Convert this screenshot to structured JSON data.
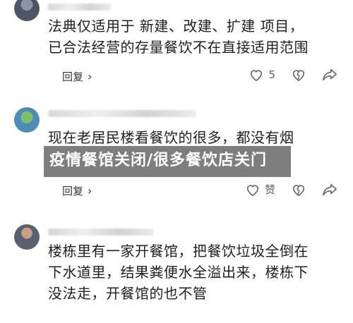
{
  "comments": [
    {
      "text": "法典仅适用于 新建、改建、扩建 项目，\n已合法经营的存量餐饮不在直接适用范围",
      "reply_label": "回复",
      "like_count": "5"
    },
    {
      "text": "现在老居民楼看餐饮的很多，都没有烟",
      "reply_label": "回复",
      "like_count": "赞"
    },
    {
      "text": "楼栋里有一家开餐馆，把餐饮垃圾全倒在\n下水道里，结果粪便水全溢出来，楼栋下\n没法走，开餐馆的也不管",
      "reply_label": "",
      "like_count": ""
    }
  ],
  "overlay": {
    "caption": "疫情餐馆关闭/很多餐饮店关门"
  },
  "icons": {
    "reply_chevron": "chevron-right-icon",
    "like": "heart-icon",
    "dislike": "heart-broken-icon",
    "share": "share-icon"
  }
}
